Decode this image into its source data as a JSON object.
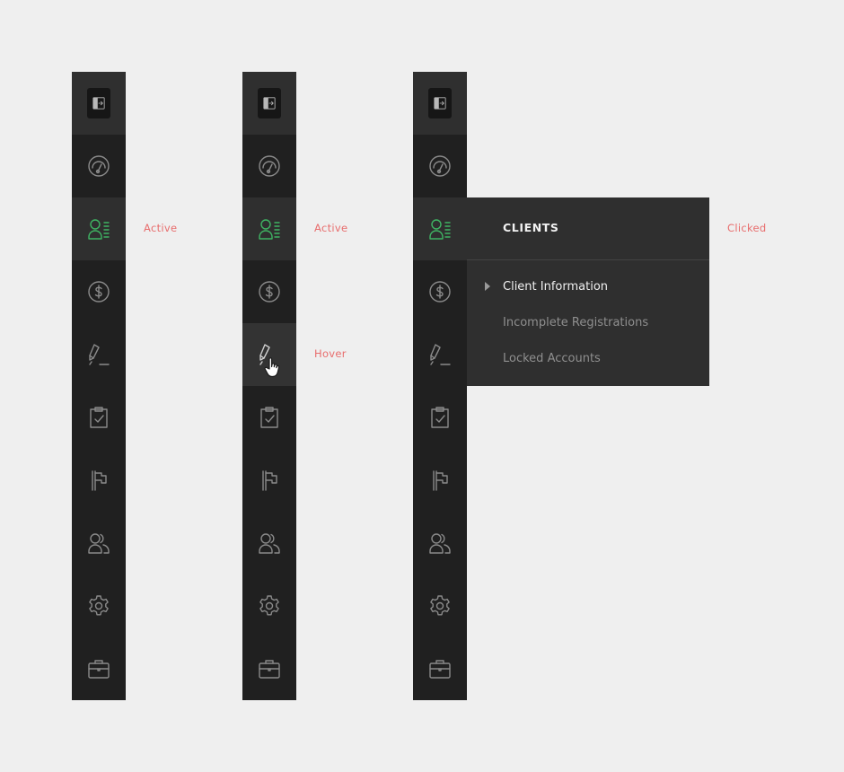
{
  "states": {
    "active_1": "Active",
    "active_2": "Active",
    "hover": "Hover",
    "clicked": "Clicked"
  },
  "sidebar": {
    "icons": [
      "panel-toggle-icon",
      "dashboard-gauge-icon",
      "clients-icon",
      "dollar-icon",
      "pen-edit-icon",
      "clipboard-check-icon",
      "flag-icon",
      "users-icon",
      "gear-icon",
      "briefcase-icon"
    ],
    "active_item": "clients",
    "hover_item": "edit"
  },
  "flyout": {
    "title": "CLIENTS",
    "items": [
      {
        "label": "Client Information",
        "current": true
      },
      {
        "label": "Incomplete Registrations",
        "current": false
      },
      {
        "label": "Locked Accounts",
        "current": false
      }
    ]
  },
  "colors": {
    "background": "#efefef",
    "sidebar": "#202020",
    "highlight": "#2f2f2f",
    "accent_green": "#3fb463",
    "label_red": "#e86d6d"
  }
}
